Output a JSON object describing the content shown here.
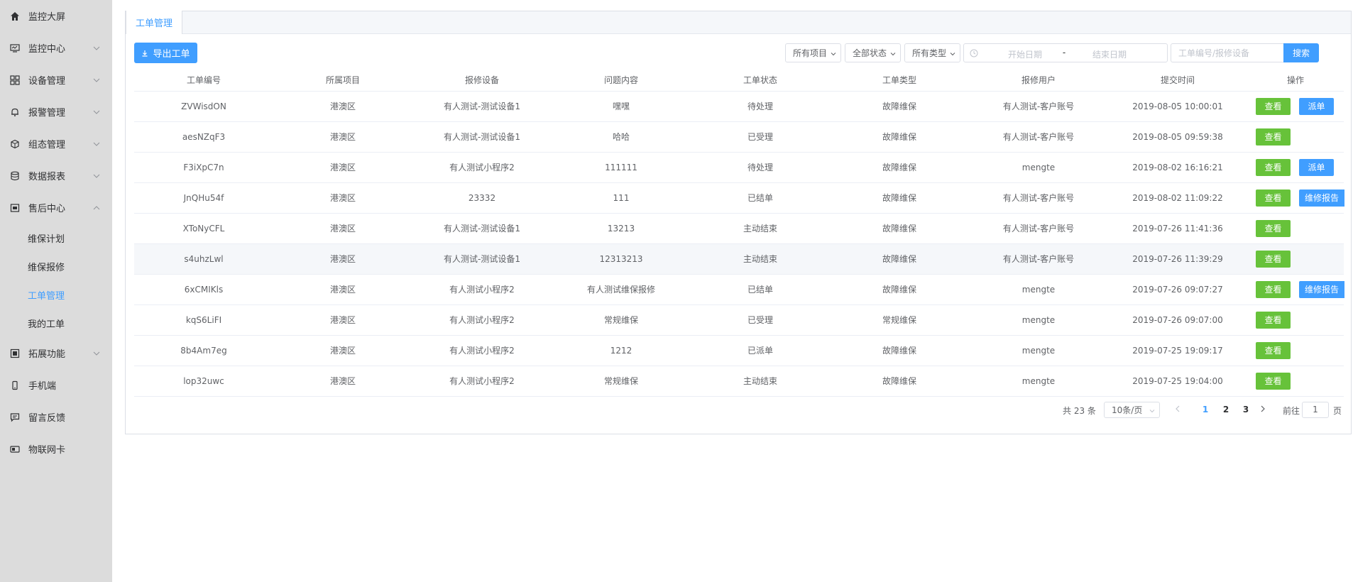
{
  "sidebar": {
    "items": [
      {
        "label": "监控大屏"
      },
      {
        "label": "监控中心"
      },
      {
        "label": "设备管理"
      },
      {
        "label": "报警管理"
      },
      {
        "label": "组态管理"
      },
      {
        "label": "数据报表"
      },
      {
        "label": "售后中心"
      },
      {
        "label": "拓展功能"
      },
      {
        "label": "手机端"
      },
      {
        "label": "留言反馈"
      },
      {
        "label": "物联网卡"
      }
    ],
    "sub_items": [
      {
        "label": "维保计划"
      },
      {
        "label": "维保报修"
      },
      {
        "label": "工单管理"
      },
      {
        "label": "我的工单"
      }
    ]
  },
  "tab": {
    "label": "工单管理"
  },
  "toolbar": {
    "export_label": "导出工单",
    "project_select": "所有项目",
    "status_select": "全部状态",
    "type_select": "所有类型",
    "date_start_placeholder": "开始日期",
    "date_separator": "-",
    "date_end_placeholder": "结束日期",
    "search_placeholder": "工单编号/报修设备",
    "search_label": "搜索"
  },
  "table": {
    "headers": [
      "工单编号",
      "所属项目",
      "报修设备",
      "问题内容",
      "工单状态",
      "工单类型",
      "报修用户",
      "提交时间",
      "操作"
    ],
    "view_label": "查看",
    "dispatch_label": "派单",
    "report_label": "维修报告",
    "rows": [
      {
        "id": "ZVWisdON",
        "project": "港澳区",
        "device": "有人测试-测试设备1",
        "content": "嘿嘿",
        "status": "待处理",
        "type": "故障维保",
        "user": "有人测试-客户账号",
        "time": "2019-08-05 10:00:01"
      },
      {
        "id": "aesNZqF3",
        "project": "港澳区",
        "device": "有人测试-测试设备1",
        "content": "哈哈",
        "status": "已受理",
        "type": "故障维保",
        "user": "有人测试-客户账号",
        "time": "2019-08-05 09:59:38"
      },
      {
        "id": "F3iXpC7n",
        "project": "港澳区",
        "device": "有人测试小程序2",
        "content": "111111",
        "status": "待处理",
        "type": "故障维保",
        "user": "mengte",
        "time": "2019-08-02 16:16:21"
      },
      {
        "id": "JnQHu54f",
        "project": "港澳区",
        "device": "23332",
        "content": "111",
        "status": "已结单",
        "type": "故障维保",
        "user": "有人测试-客户账号",
        "time": "2019-08-02 11:09:22"
      },
      {
        "id": "XToNyCFL",
        "project": "港澳区",
        "device": "有人测试-测试设备1",
        "content": "13213",
        "status": "主动结束",
        "type": "故障维保",
        "user": "有人测试-客户账号",
        "time": "2019-07-26 11:41:36"
      },
      {
        "id": "s4uhzLwl",
        "project": "港澳区",
        "device": "有人测试-测试设备1",
        "content": "12313213",
        "status": "主动结束",
        "type": "故障维保",
        "user": "有人测试-客户账号",
        "time": "2019-07-26 11:39:29"
      },
      {
        "id": "6xCMIKls",
        "project": "港澳区",
        "device": "有人测试小程序2",
        "content": "有人测试维保报修",
        "status": "已结单",
        "type": "故障维保",
        "user": "mengte",
        "time": "2019-07-26 09:07:27"
      },
      {
        "id": "kqS6LiFI",
        "project": "港澳区",
        "device": "有人测试小程序2",
        "content": "常规维保",
        "status": "已受理",
        "type": "常规维保",
        "user": "mengte",
        "time": "2019-07-26 09:07:00"
      },
      {
        "id": "8b4Am7eg",
        "project": "港澳区",
        "device": "有人测试小程序2",
        "content": "1212",
        "status": "已派单",
        "type": "故障维保",
        "user": "mengte",
        "time": "2019-07-25 19:09:17"
      },
      {
        "id": "lop32uwc",
        "project": "港澳区",
        "device": "有人测试小程序2",
        "content": "常规维保",
        "status": "主动结束",
        "type": "故障维保",
        "user": "mengte",
        "time": "2019-07-25 19:04:00"
      }
    ]
  },
  "pagination": {
    "total_text": "共 23 条",
    "page_size": "10条/页",
    "pages": [
      "1",
      "2",
      "3"
    ],
    "goto_label": "前往",
    "jump_value": "1",
    "unit_label": "页"
  },
  "colors": {
    "accent": "#409eff",
    "success": "#67c23a",
    "danger": "#f56c6c",
    "sidebar_bg": "#dcdcdc"
  }
}
